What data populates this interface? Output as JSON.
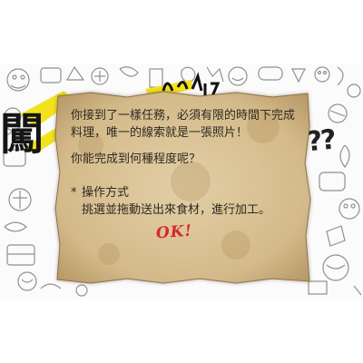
{
  "scene": {
    "title_art": "闖",
    "title_art_fragment": "!!",
    "question_marks": "??",
    "accent_color": "#f2e21c",
    "ink_color": "#1a1a1a"
  },
  "dialog": {
    "intro": "你接到了一樣任務，必須有限的時間下完成料理，唯一的線索就是一張照片！",
    "question": "你能完成到何種程度呢？",
    "controls_bullet": "*",
    "controls_title": "操作方式",
    "controls_desc": "挑選並拖動送出來食材，進行加工。",
    "ok_label": "OK!",
    "paper_color": "#d8c29a",
    "ok_color": "#d8262a"
  }
}
